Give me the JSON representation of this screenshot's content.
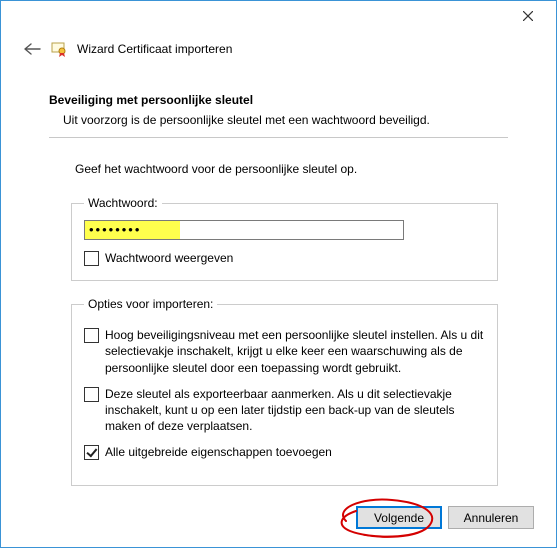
{
  "titlebar": {
    "close": "×"
  },
  "header": {
    "title": "Wizard Certificaat importeren"
  },
  "section": {
    "subtitle": "Beveiliging met persoonlijke sleutel",
    "subdesc": "Uit voorzorg is de persoonlijke sleutel met een wachtwoord beveiligd.",
    "instruction": "Geef het wachtwoord voor de persoonlijke sleutel op."
  },
  "password_group": {
    "legend": "Wachtwoord:",
    "value_masked": "••••••••",
    "show_label": "Wachtwoord weergeven"
  },
  "options_group": {
    "legend": "Opties voor importeren:",
    "opt1": "Hoog beveiligingsniveau met een persoonlijke sleutel instellen. Als u dit selectievakje inschakelt, krijgt u elke keer een waarschuwing als de persoonlijke sleutel door een toepassing wordt gebruikt.",
    "opt2": "Deze sleutel als exporteerbaar aanmerken. Als u dit selectievakje inschakelt, kunt u op een later tijdstip een back-up van de sleutels maken of deze verplaatsen.",
    "opt3": "Alle uitgebreide eigenschappen toevoegen"
  },
  "buttons": {
    "next": "Volgende",
    "cancel": "Annuleren"
  }
}
